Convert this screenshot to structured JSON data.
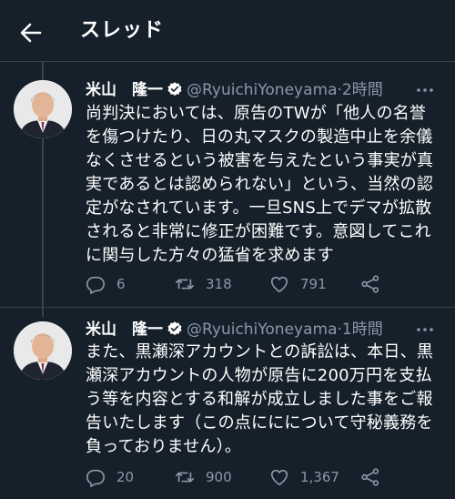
{
  "header": {
    "title": "スレッド",
    "back_icon": "back-arrow-icon"
  },
  "colors": {
    "background": "#15202b",
    "secondary_text": "#8899a6",
    "verified_badge": "#ffffff",
    "border": "#38444d"
  },
  "tweets": [
    {
      "name": "米山　隆一",
      "handle": "@RyuichiYoneyama",
      "dot": "·",
      "time": "2時間",
      "text": "尚判決においては、原告のTWが「他人の名誉を傷つけたり、日の丸マスクの製造中止を余儀なくさせるという被害を与えたという事実が真実であるとは認められない」という、当然の認定がなされています。一旦SNS上でデマが拡散されると非常に修正が困難です。意図してこれに関与した方々の猛省を求めます",
      "replies": "6",
      "retweets": "318",
      "likes": "791"
    },
    {
      "name": "米山　隆一",
      "handle": "@RyuichiYoneyama",
      "dot": "·",
      "time": "1時間",
      "text": "また、黒瀬深アカウントとの訴訟は、本日、黒瀬深アカウントの人物が原告に200万円を支払う等を内容とする和解が成立しました事をご報告いたします（この点ににについて守秘義務を負っておりません）。",
      "replies": "20",
      "retweets": "900",
      "likes": "1,367"
    }
  ]
}
